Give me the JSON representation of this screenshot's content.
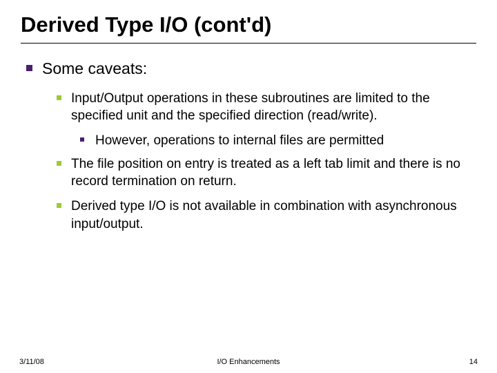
{
  "title": "Derived Type I/O (cont'd)",
  "lvl1": {
    "text": "Some caveats:"
  },
  "lvl2": [
    {
      "text": "Input/Output operations in these subroutines are limited to the specified unit and the specified direction (read/write)."
    },
    {
      "text": "The file position on entry is treated as a left tab limit and there is no record termination on return."
    },
    {
      "text": "Derived type I/O is not available in combination with asynchronous input/output."
    }
  ],
  "lvl3": {
    "text": "However, operations to internal files are permitted"
  },
  "footer": {
    "date": "3/11/08",
    "center": "I/O Enhancements",
    "page": "14"
  }
}
